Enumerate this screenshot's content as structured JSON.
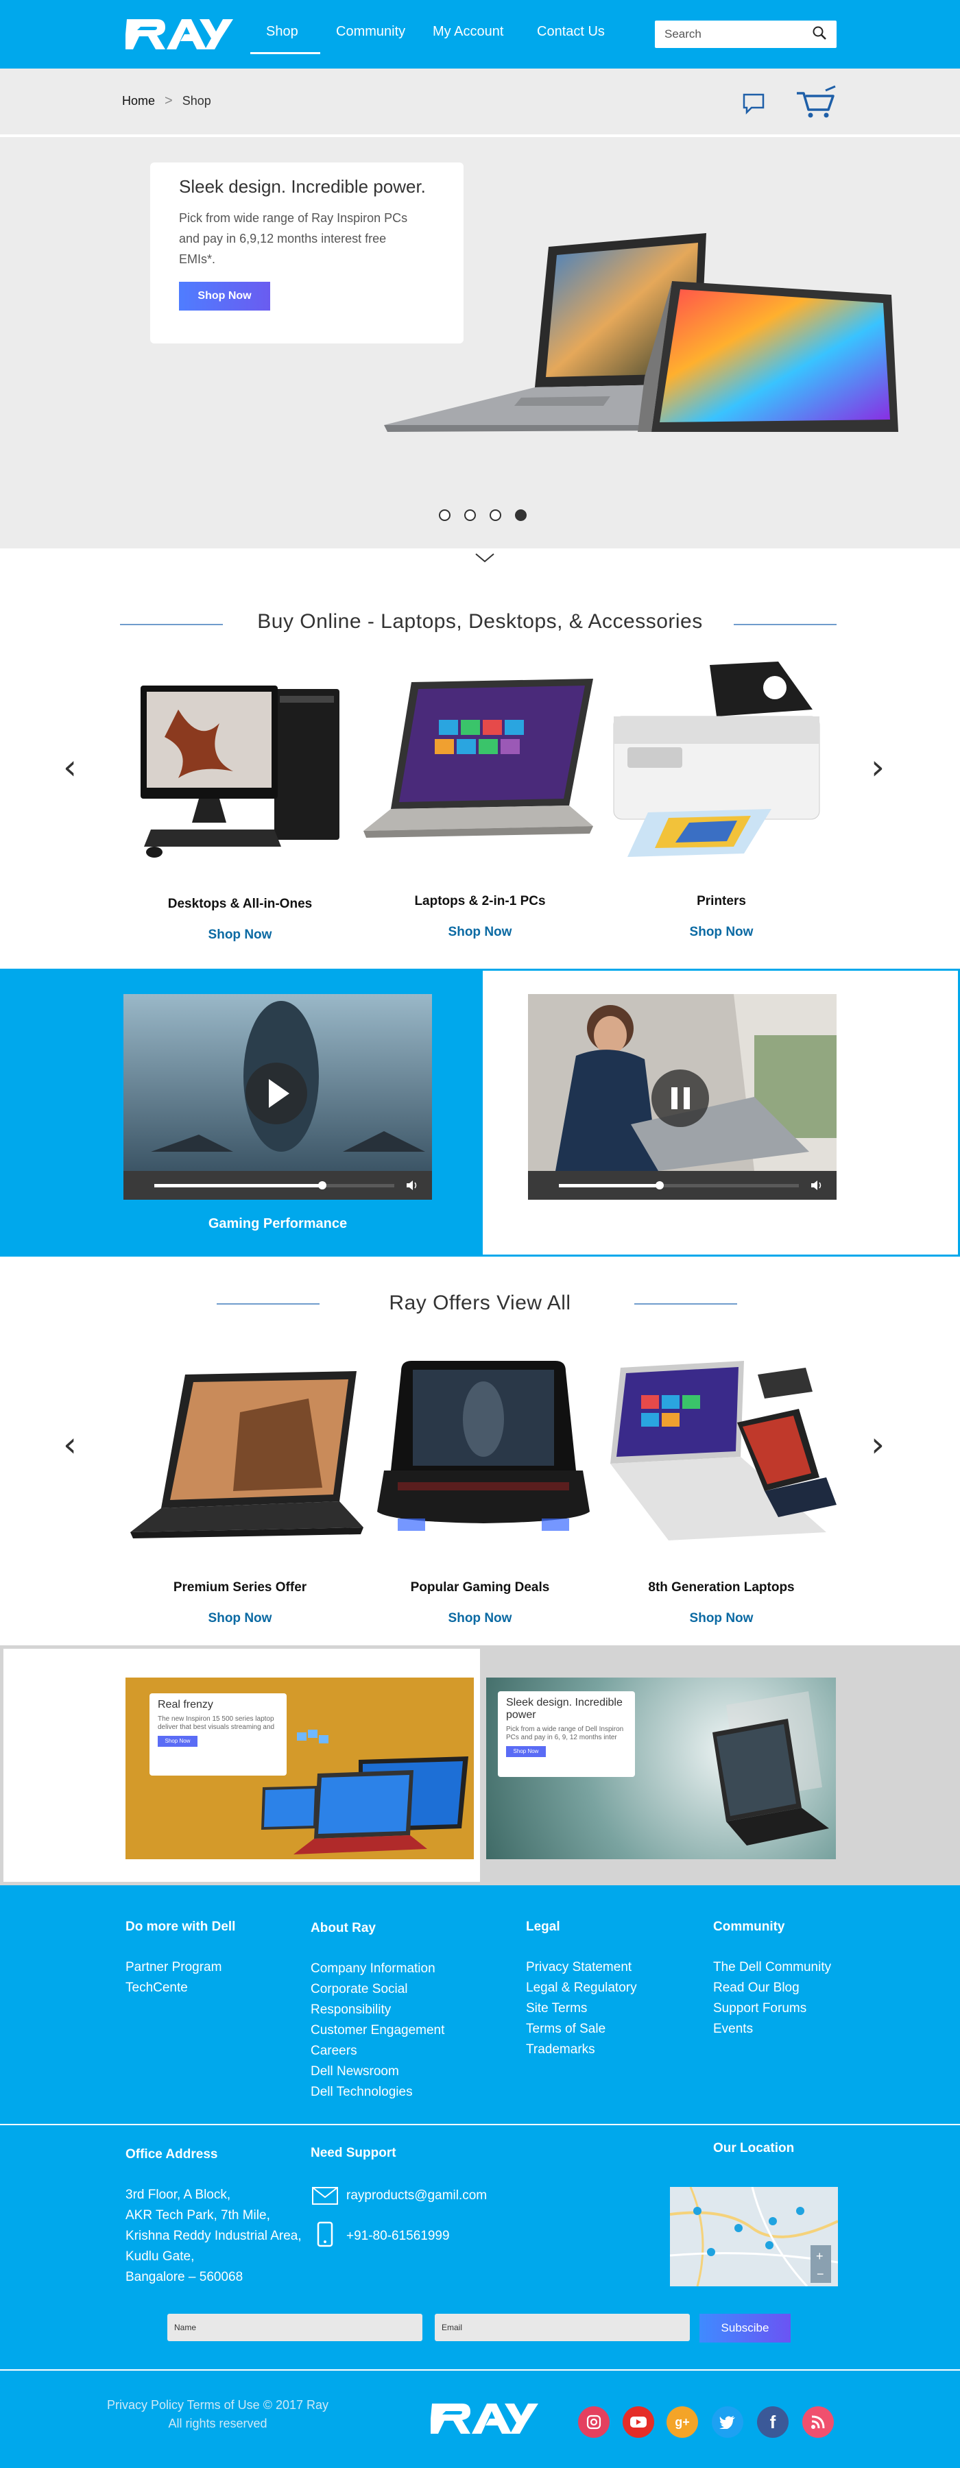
{
  "header": {
    "nav": [
      "Shop",
      "Community",
      "My Account",
      "Contact Us"
    ],
    "search_placeholder": "Search",
    "brand_color": "#00a8ec"
  },
  "breadcrumb": {
    "home": "Home",
    "separator": ">",
    "current": "Shop"
  },
  "hero": {
    "title": "Sleek design. Incredible power.",
    "description": "Pick from wide range of Ray Inspiron PCs and pay in 6,9,12 months interest free EMIs*.",
    "button": "Shop Now",
    "slides": 4,
    "active_slide": 4
  },
  "buy_online": {
    "title": "Buy Online - Laptops, Desktops, & Accessories",
    "products": [
      {
        "name": "Desktops & All-in-Ones",
        "link": "Shop Now"
      },
      {
        "name": "Laptops & 2-in-1 PCs",
        "link": "Shop Now"
      },
      {
        "name": "Printers",
        "link": "Shop Now"
      }
    ]
  },
  "videos": {
    "left": {
      "label": "Gaming Performance",
      "state": "play",
      "progress": 0.7
    },
    "right": {
      "state": "pause",
      "progress": 0.42
    }
  },
  "offers": {
    "title": "Ray Offers View All",
    "products": [
      {
        "name": "Premium Series Offer",
        "link": "Shop Now"
      },
      {
        "name": "Popular Gaming Deals",
        "link": "Shop Now"
      },
      {
        "name": "8th Generation Laptops",
        "link": "Shop Now"
      }
    ]
  },
  "promos": [
    {
      "title": "Real frenzy",
      "desc": "The new Inspiron 15 500 series laptop deliver that best visuals streaming and",
      "button": "Shop Now"
    },
    {
      "title": "Sleek design. Incredible power",
      "desc": "Pick from a wide range of Dell Inspiron PCs and pay in 6, 9, 12 months inter",
      "button": "Shop Now"
    }
  ],
  "footer": {
    "columns": [
      {
        "title": "Do more with Dell",
        "links": [
          "Partner Program",
          "TechCente"
        ]
      },
      {
        "title": "About Ray",
        "links": [
          "Company Information",
          "Corporate Social",
          "Responsibility",
          "Customer Engagement",
          "Careers",
          "Dell Newsroom",
          "Dell Technologies"
        ]
      },
      {
        "title": "Legal",
        "links": [
          "Privacy Statement",
          "Legal & Regulatory",
          "Site Terms",
          "Terms of Sale",
          "Trademarks"
        ]
      },
      {
        "title": "Community",
        "links": [
          "The Dell Community",
          "Read Our Blog",
          "Support Forums",
          "Events"
        ]
      }
    ],
    "office": {
      "title": "Office Address",
      "lines": [
        "3rd Floor, A Block,",
        "AKR Tech Park, 7th Mile,",
        "Krishna Reddy Industrial Area,",
        "Kudlu Gate,",
        "Bangalore – 560068"
      ]
    },
    "support": {
      "title": "Need Support",
      "email": "rayproducts@gamil.com",
      "phone": "+91-80-61561999"
    },
    "location": {
      "title": "Our Location"
    },
    "subscribe": {
      "name_placeholder": "Name",
      "email_placeholder": "Email",
      "button": "Subscibe"
    },
    "copyright": [
      "Privacy Policy Terms of Use © 2017 Ray",
      "All rights reserved"
    ],
    "social": [
      {
        "icon": "instagram-icon",
        "color": "#e4405f"
      },
      {
        "icon": "youtube-icon",
        "color": "#e52d27"
      },
      {
        "icon": "google-plus-icon",
        "color": "#f4a428"
      },
      {
        "icon": "twitter-icon",
        "color": "#1da1f2"
      },
      {
        "icon": "facebook-icon",
        "color": "#3b5998"
      },
      {
        "icon": "rss-icon",
        "color": "#f0506e"
      }
    ]
  }
}
